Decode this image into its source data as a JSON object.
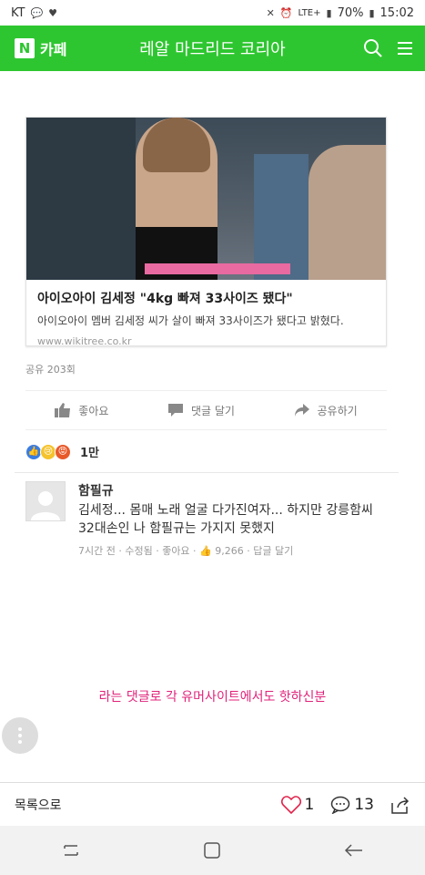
{
  "status_bar": {
    "carrier": "KT",
    "network": "LTE+",
    "battery": "70%",
    "time": "15:02"
  },
  "app_bar": {
    "brand_logo": "N",
    "brand_text": "카페",
    "title": "레알 마드리드 코리아"
  },
  "card": {
    "title": "아이오아이 김세정 \"4kg 빠져 33사이즈 됐다\"",
    "description": "아이오아이 멤버 김세정 씨가 살이 빠져 33사이즈가 됐다고 밝혔다.",
    "url": "www.wikitree.co.kr"
  },
  "share_count": "공유 203회",
  "actions": {
    "like": "좋아요",
    "comment": "댓글 달기",
    "share": "공유하기"
  },
  "reactions": {
    "count": "1만"
  },
  "comment": {
    "author": "함필규",
    "text": "김세정... 몸매 노래 얼굴 다가진여자... 하지만 강릉함씨 32대손인 나 함필규는 가지지 못했지",
    "meta": "7시간 전 · 수정됨 · 좋아요 · 👍 9,266 · 답글 달기"
  },
  "caption": "라는 댓글로 각 유머사이트에서도 핫하신분",
  "bottom_bar": {
    "list_label": "목록으로",
    "likes": "1",
    "comments": "13"
  },
  "colors": {
    "brand_green": "#2ec630",
    "caption_pink": "#e0227a"
  }
}
